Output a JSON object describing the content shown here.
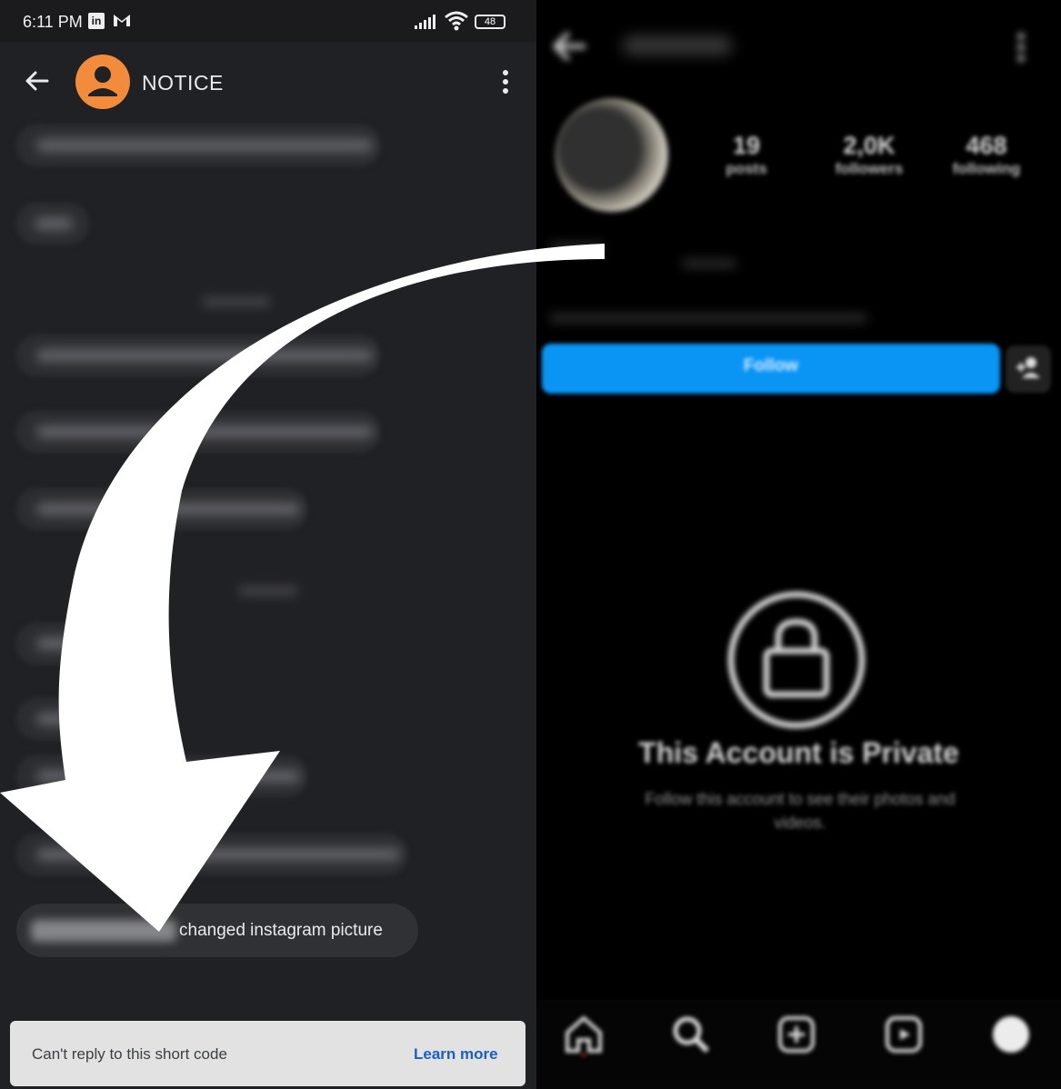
{
  "status_bar": {
    "time": "6:11 PM",
    "battery": "48",
    "icons": [
      "linkedin-icon",
      "gmail-icon",
      "signal-icon",
      "wifi-icon",
      "battery-icon"
    ]
  },
  "messages_app": {
    "title": "NOTICE",
    "last_message_text": "changed instagram picture",
    "reply_notice": "Can't reply to this short code",
    "learn_more": "Learn more",
    "colors": {
      "background": "#202124",
      "avatar": "#f28b3a",
      "link": "#1a5fc7"
    }
  },
  "instagram_profile": {
    "stats": [
      {
        "number": "19",
        "label": "posts"
      },
      {
        "number": "2,0K",
        "label": "followers"
      },
      {
        "number": "468",
        "label": "following"
      }
    ],
    "follow_button": "Follow",
    "private_title": "This Account is Private",
    "private_subtitle": "Follow this account to see their photos and videos.",
    "colors": {
      "follow": "#0a95f5",
      "background": "#000000"
    }
  },
  "overlay": {
    "arrow_color": "#ffffff",
    "arrow_icon": "curved-arrow-icon"
  }
}
